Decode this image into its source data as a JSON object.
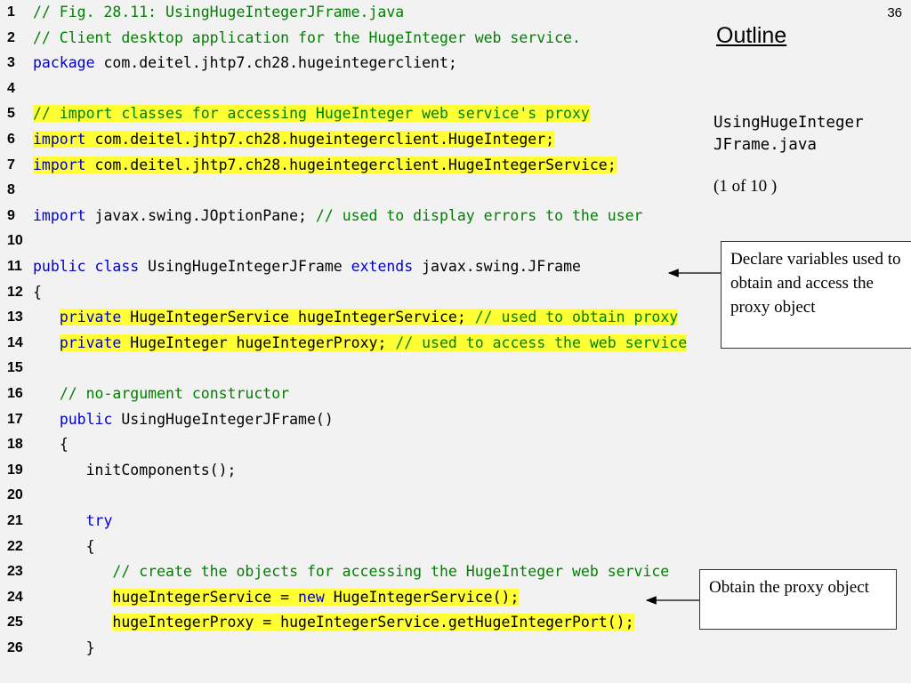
{
  "slide": {
    "page_number": "36",
    "outline_title": "Outline",
    "file_name_line1": "UsingHugeInteger",
    "file_name_line2": "JFrame.java",
    "part": "(1 of 10 )"
  },
  "callouts": [
    "Declare variables used to obtain and access the proxy object",
    "Obtain the proxy object"
  ],
  "code_lines": [
    {
      "n": "1",
      "hl": false,
      "segs": [
        {
          "t": "// Fig. 28.11: UsingHugeIntegerJFrame.java",
          "c": "c"
        }
      ]
    },
    {
      "n": "2",
      "hl": false,
      "segs": [
        {
          "t": "// Client desktop application for the HugeInteger web service.",
          "c": "c"
        }
      ]
    },
    {
      "n": "3",
      "hl": false,
      "segs": [
        {
          "t": "package",
          "c": "k"
        },
        {
          "t": " com.deitel.jhtp7.ch28.hugeintegerclient;",
          "c": "t"
        }
      ]
    },
    {
      "n": "4",
      "hl": false,
      "segs": []
    },
    {
      "n": "5",
      "hl": true,
      "segs": [
        {
          "t": "// import classes for accessing HugeInteger web service's proxy",
          "c": "c"
        }
      ]
    },
    {
      "n": "6",
      "hl": true,
      "segs": [
        {
          "t": "import",
          "c": "k"
        },
        {
          "t": " com.deitel.jhtp7.ch28.hugeintegerclient.HugeInteger;",
          "c": "t"
        }
      ]
    },
    {
      "n": "7",
      "hl": true,
      "segs": [
        {
          "t": "import",
          "c": "k"
        },
        {
          "t": " com.deitel.jhtp7.ch28.hugeintegerclient.HugeIntegerService;",
          "c": "t"
        }
      ]
    },
    {
      "n": "8",
      "hl": false,
      "segs": []
    },
    {
      "n": "9",
      "hl": false,
      "segs": [
        {
          "t": "import",
          "c": "k"
        },
        {
          "t": " javax.swing.JOptionPane; ",
          "c": "t"
        },
        {
          "t": "// used to display errors to the user",
          "c": "c"
        }
      ]
    },
    {
      "n": "10",
      "hl": false,
      "segs": []
    },
    {
      "n": "11",
      "hl": false,
      "segs": [
        {
          "t": "public",
          "c": "k"
        },
        {
          "t": " ",
          "c": "t"
        },
        {
          "t": "class",
          "c": "k"
        },
        {
          "t": " UsingHugeIntegerJFrame ",
          "c": "t"
        },
        {
          "t": "extends",
          "c": "k"
        },
        {
          "t": " javax.swing.JFrame",
          "c": "t"
        }
      ]
    },
    {
      "n": "12",
      "hl": false,
      "segs": [
        {
          "t": "{",
          "c": "t"
        }
      ]
    },
    {
      "n": "13",
      "hl": true,
      "indent": "   ",
      "segs": [
        {
          "t": "private",
          "c": "k"
        },
        {
          "t": " HugeIntegerService hugeIntegerService; ",
          "c": "t"
        },
        {
          "t": "// used to obtain proxy",
          "c": "c"
        }
      ]
    },
    {
      "n": "14",
      "hl": true,
      "indent": "   ",
      "segs": [
        {
          "t": "private",
          "c": "k"
        },
        {
          "t": " HugeInteger hugeIntegerProxy; ",
          "c": "t"
        },
        {
          "t": "// used to access the web service",
          "c": "c"
        }
      ]
    },
    {
      "n": "15",
      "hl": false,
      "segs": []
    },
    {
      "n": "16",
      "hl": false,
      "indent": "   ",
      "segs": [
        {
          "t": "// no-argument constructor",
          "c": "c"
        }
      ]
    },
    {
      "n": "17",
      "hl": false,
      "indent": "   ",
      "segs": [
        {
          "t": "public",
          "c": "k"
        },
        {
          "t": " UsingHugeIntegerJFrame()",
          "c": "t"
        }
      ]
    },
    {
      "n": "18",
      "hl": false,
      "indent": "   ",
      "segs": [
        {
          "t": "{",
          "c": "t"
        }
      ]
    },
    {
      "n": "19",
      "hl": false,
      "indent": "      ",
      "segs": [
        {
          "t": "initComponents();",
          "c": "t"
        }
      ]
    },
    {
      "n": "20",
      "hl": false,
      "segs": []
    },
    {
      "n": "21",
      "hl": false,
      "indent": "      ",
      "segs": [
        {
          "t": "try",
          "c": "k"
        }
      ]
    },
    {
      "n": "22",
      "hl": false,
      "indent": "      ",
      "segs": [
        {
          "t": "{",
          "c": "t"
        }
      ]
    },
    {
      "n": "23",
      "hl": false,
      "indent": "         ",
      "segs": [
        {
          "t": "// create the objects for accessing the HugeInteger web service",
          "c": "c"
        }
      ]
    },
    {
      "n": "24",
      "hl": true,
      "indent": "         ",
      "segs": [
        {
          "t": "hugeIntegerService = ",
          "c": "t"
        },
        {
          "t": "new",
          "c": "k"
        },
        {
          "t": " HugeIntegerService();",
          "c": "t"
        }
      ]
    },
    {
      "n": "25",
      "hl": true,
      "indent": "         ",
      "segs": [
        {
          "t": "hugeIntegerProxy = hugeIntegerService.getHugeIntegerPort();",
          "c": "t"
        }
      ]
    },
    {
      "n": "26",
      "hl": false,
      "indent": "      ",
      "segs": [
        {
          "t": "}",
          "c": "t"
        }
      ]
    }
  ]
}
